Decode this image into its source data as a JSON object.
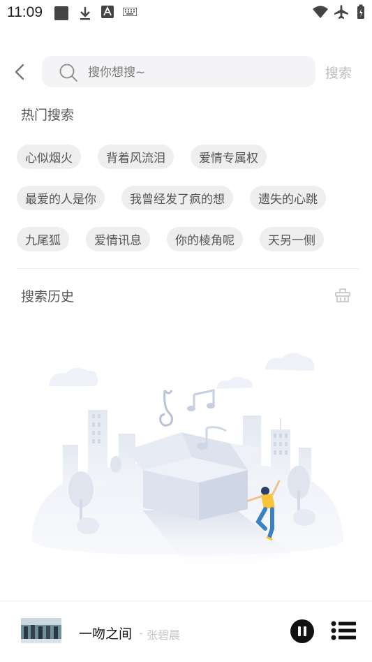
{
  "status_bar": {
    "time": "11:09"
  },
  "search": {
    "placeholder": "搜你想搜~",
    "value": "",
    "button_label": "搜索"
  },
  "hot_search": {
    "title": "热门搜索",
    "rows": [
      [
        "心似烟火",
        "背着风流泪",
        "爱情专属权"
      ],
      [
        "最爱的人是你",
        "我曾经发了疯的想",
        "遗失的心跳"
      ],
      [
        "九尾狐",
        "爱情讯息",
        "你的棱角呢",
        "天另一侧"
      ]
    ]
  },
  "history": {
    "title": "搜索历史"
  },
  "player": {
    "song_title": "一吻之间",
    "separator": "-",
    "artist": "张碧晨"
  }
}
